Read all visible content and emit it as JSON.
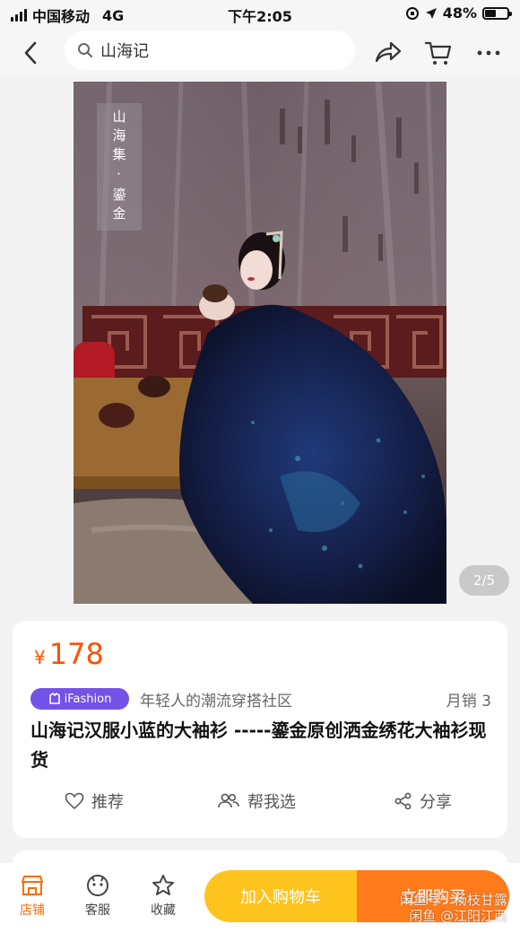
{
  "status_bar": {
    "carrier": "中国移动",
    "network": "4G",
    "time": "下午2:05",
    "battery_percent": "48%",
    "battery_level": 0.48
  },
  "nav": {
    "search_query": "山海记",
    "icons": [
      "back-arrow-icon",
      "search-icon",
      "share-icon",
      "cart-icon",
      "more-icon"
    ]
  },
  "gallery": {
    "label": "山海集·鎏金",
    "counter": "2/5"
  },
  "product": {
    "currency": "¥",
    "price": "178",
    "badge": "iFashion",
    "badge_text": "年轻人的潮流穿搭社区",
    "monthly_sales": "月销 3",
    "title": "山海记汉服小蓝的大袖衫 -----鎏金原创洒金绣花大袖衫现货"
  },
  "actions": {
    "recommend": "推荐",
    "help_choose": "帮我选",
    "share": "分享"
  },
  "bottom_bar": {
    "store": "店铺",
    "service": "客服",
    "favorite": "收藏",
    "add_to_cart": "加入购物车",
    "buy_now": "立即购买"
  },
  "watermark": {
    "line1": "闲鱼号：杨枝甘露",
    "line2": "闲鱼 @江阳江西"
  },
  "colors": {
    "accent": "#ff5000",
    "badge": "#7352e6",
    "cart_button": "#ffc31d",
    "buy_button": "#ff7b1c"
  }
}
